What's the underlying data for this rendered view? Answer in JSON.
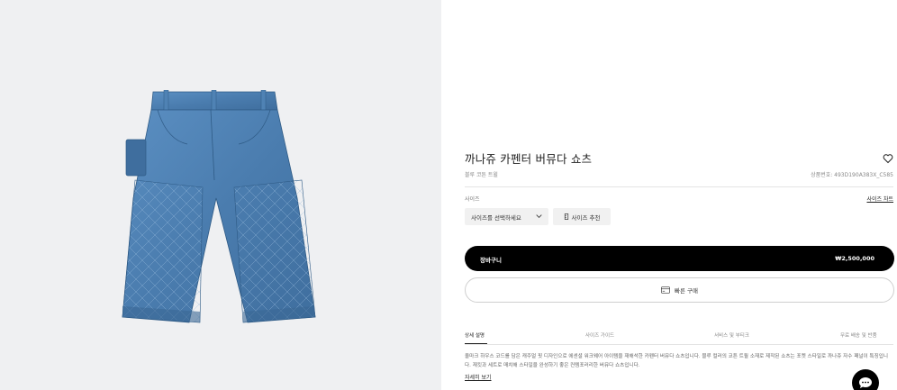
{
  "product": {
    "title": "까나쥬 카펜터 버뮤다 쇼츠",
    "subtitle": "블루 코튼 트윌",
    "ref": "상품번호: 493D190A383X_C585"
  },
  "size": {
    "label": "사이즈",
    "guide_link": "사이즈 차트",
    "select_placeholder": "사이즈를 선택하세요",
    "recommend_label": "사이즈 추천"
  },
  "cart": {
    "label": "장바구니",
    "price": "₩2,500,000"
  },
  "quick_buy": {
    "label": "빠른 구매"
  },
  "tabs": [
    {
      "label": "상세 설명",
      "active": true
    },
    {
      "label": "사이즈 가이드",
      "active": false
    },
    {
      "label": "서비스 및 부티크",
      "active": false
    },
    {
      "label": "무료 배송 및 반품",
      "active": false
    }
  ],
  "description": {
    "text": "올마크 하우스 코드를 담은 캐주얼 핏 디자인으로 에센셜 워크웨어 아이템을 재해석한 카펜터 버뮤다 쇼츠입니다. 블루 컬러의 코튼 트윌 소재로 제작된 쇼츠는 포켓 스타일로 까나쥬 자수 패널이 특징입니다. 재킷과 세트로 매치해 스타일을 완성하기 좋은 컨템포러리한 버뮤다 쇼츠입니다.",
    "more_link": "자세히 보기"
  },
  "icons": {
    "wishlist": "heart-icon",
    "chevron": "chevron-down-icon",
    "ruler": "ruler-icon",
    "card": "card-icon",
    "chat": "chat-icon"
  },
  "colors": {
    "accent": "#000000",
    "image_bg": "#eff0f2",
    "denim": "#4a7cae"
  }
}
